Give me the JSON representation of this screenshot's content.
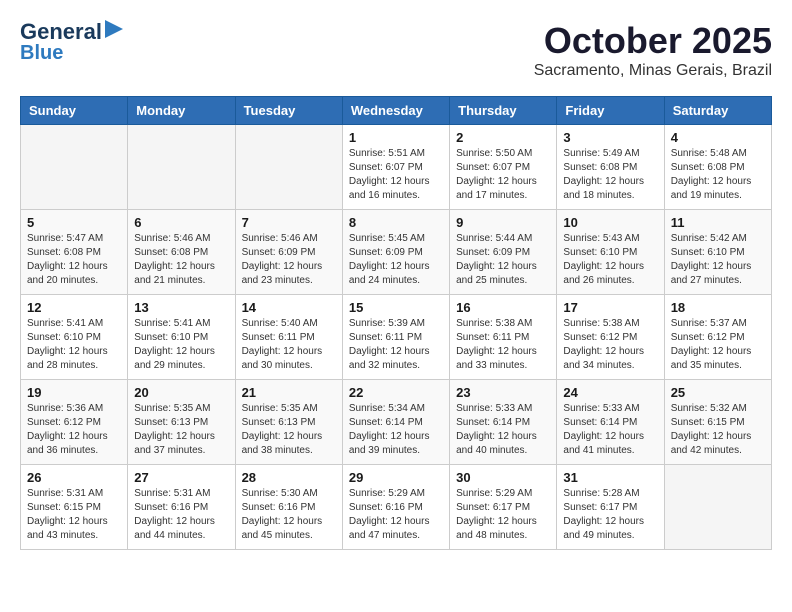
{
  "logo": {
    "text_general": "General",
    "text_blue": "Blue"
  },
  "header": {
    "month": "October 2025",
    "location": "Sacramento, Minas Gerais, Brazil"
  },
  "weekdays": [
    "Sunday",
    "Monday",
    "Tuesday",
    "Wednesday",
    "Thursday",
    "Friday",
    "Saturday"
  ],
  "weeks": [
    [
      {
        "day": "",
        "info": ""
      },
      {
        "day": "",
        "info": ""
      },
      {
        "day": "",
        "info": ""
      },
      {
        "day": "1",
        "info": "Sunrise: 5:51 AM\nSunset: 6:07 PM\nDaylight: 12 hours\nand 16 minutes."
      },
      {
        "day": "2",
        "info": "Sunrise: 5:50 AM\nSunset: 6:07 PM\nDaylight: 12 hours\nand 17 minutes."
      },
      {
        "day": "3",
        "info": "Sunrise: 5:49 AM\nSunset: 6:08 PM\nDaylight: 12 hours\nand 18 minutes."
      },
      {
        "day": "4",
        "info": "Sunrise: 5:48 AM\nSunset: 6:08 PM\nDaylight: 12 hours\nand 19 minutes."
      }
    ],
    [
      {
        "day": "5",
        "info": "Sunrise: 5:47 AM\nSunset: 6:08 PM\nDaylight: 12 hours\nand 20 minutes."
      },
      {
        "day": "6",
        "info": "Sunrise: 5:46 AM\nSunset: 6:08 PM\nDaylight: 12 hours\nand 21 minutes."
      },
      {
        "day": "7",
        "info": "Sunrise: 5:46 AM\nSunset: 6:09 PM\nDaylight: 12 hours\nand 23 minutes."
      },
      {
        "day": "8",
        "info": "Sunrise: 5:45 AM\nSunset: 6:09 PM\nDaylight: 12 hours\nand 24 minutes."
      },
      {
        "day": "9",
        "info": "Sunrise: 5:44 AM\nSunset: 6:09 PM\nDaylight: 12 hours\nand 25 minutes."
      },
      {
        "day": "10",
        "info": "Sunrise: 5:43 AM\nSunset: 6:10 PM\nDaylight: 12 hours\nand 26 minutes."
      },
      {
        "day": "11",
        "info": "Sunrise: 5:42 AM\nSunset: 6:10 PM\nDaylight: 12 hours\nand 27 minutes."
      }
    ],
    [
      {
        "day": "12",
        "info": "Sunrise: 5:41 AM\nSunset: 6:10 PM\nDaylight: 12 hours\nand 28 minutes."
      },
      {
        "day": "13",
        "info": "Sunrise: 5:41 AM\nSunset: 6:10 PM\nDaylight: 12 hours\nand 29 minutes."
      },
      {
        "day": "14",
        "info": "Sunrise: 5:40 AM\nSunset: 6:11 PM\nDaylight: 12 hours\nand 30 minutes."
      },
      {
        "day": "15",
        "info": "Sunrise: 5:39 AM\nSunset: 6:11 PM\nDaylight: 12 hours\nand 32 minutes."
      },
      {
        "day": "16",
        "info": "Sunrise: 5:38 AM\nSunset: 6:11 PM\nDaylight: 12 hours\nand 33 minutes."
      },
      {
        "day": "17",
        "info": "Sunrise: 5:38 AM\nSunset: 6:12 PM\nDaylight: 12 hours\nand 34 minutes."
      },
      {
        "day": "18",
        "info": "Sunrise: 5:37 AM\nSunset: 6:12 PM\nDaylight: 12 hours\nand 35 minutes."
      }
    ],
    [
      {
        "day": "19",
        "info": "Sunrise: 5:36 AM\nSunset: 6:12 PM\nDaylight: 12 hours\nand 36 minutes."
      },
      {
        "day": "20",
        "info": "Sunrise: 5:35 AM\nSunset: 6:13 PM\nDaylight: 12 hours\nand 37 minutes."
      },
      {
        "day": "21",
        "info": "Sunrise: 5:35 AM\nSunset: 6:13 PM\nDaylight: 12 hours\nand 38 minutes."
      },
      {
        "day": "22",
        "info": "Sunrise: 5:34 AM\nSunset: 6:14 PM\nDaylight: 12 hours\nand 39 minutes."
      },
      {
        "day": "23",
        "info": "Sunrise: 5:33 AM\nSunset: 6:14 PM\nDaylight: 12 hours\nand 40 minutes."
      },
      {
        "day": "24",
        "info": "Sunrise: 5:33 AM\nSunset: 6:14 PM\nDaylight: 12 hours\nand 41 minutes."
      },
      {
        "day": "25",
        "info": "Sunrise: 5:32 AM\nSunset: 6:15 PM\nDaylight: 12 hours\nand 42 minutes."
      }
    ],
    [
      {
        "day": "26",
        "info": "Sunrise: 5:31 AM\nSunset: 6:15 PM\nDaylight: 12 hours\nand 43 minutes."
      },
      {
        "day": "27",
        "info": "Sunrise: 5:31 AM\nSunset: 6:16 PM\nDaylight: 12 hours\nand 44 minutes."
      },
      {
        "day": "28",
        "info": "Sunrise: 5:30 AM\nSunset: 6:16 PM\nDaylight: 12 hours\nand 45 minutes."
      },
      {
        "day": "29",
        "info": "Sunrise: 5:29 AM\nSunset: 6:16 PM\nDaylight: 12 hours\nand 47 minutes."
      },
      {
        "day": "30",
        "info": "Sunrise: 5:29 AM\nSunset: 6:17 PM\nDaylight: 12 hours\nand 48 minutes."
      },
      {
        "day": "31",
        "info": "Sunrise: 5:28 AM\nSunset: 6:17 PM\nDaylight: 12 hours\nand 49 minutes."
      },
      {
        "day": "",
        "info": ""
      }
    ]
  ]
}
